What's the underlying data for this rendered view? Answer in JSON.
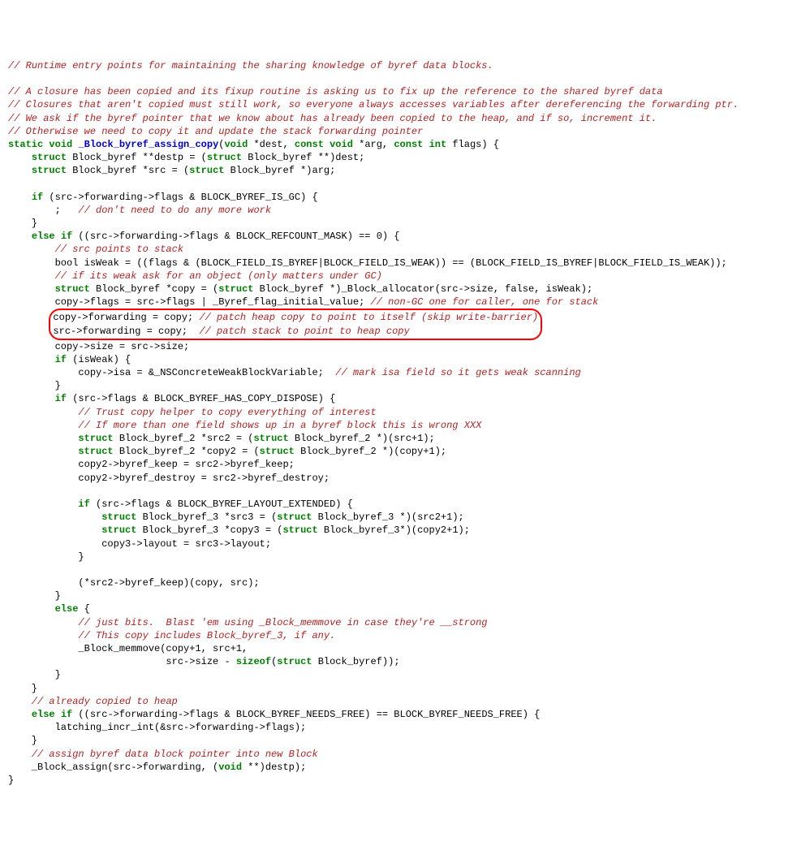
{
  "c1": "// Runtime entry points for maintaining the sharing knowledge of byref data blocks.",
  "blank": "",
  "c2": "// A closure has been copied and its fixup routine is asking us to fix up the reference to the shared byref data",
  "c3": "// Closures that aren't copied must still work, so everyone always accesses variables after dereferencing the forwarding ptr.",
  "c4": "// We ask if the byref pointer that we know about has already been copied to the heap, and if so, increment it.",
  "c5": "// Otherwise we need to copy it and update the stack forwarding pointer",
  "fnsig": {
    "k1": "static",
    "k2": "void",
    "name": "_Block_byref_assign_copy",
    "k3": "void",
    "p1": " *dest, ",
    "k4": "const",
    "k5": "void",
    "p2": " *arg, ",
    "k6": "const",
    "k7": "int",
    "p3": " flags) {"
  },
  "l7": {
    "k": "struct",
    "t1": " Block_byref **destp = (",
    "k2": "struct",
    "t2": " Block_byref **)dest;"
  },
  "l8": {
    "k": "struct",
    "t1": " Block_byref *src = (",
    "k2": "struct",
    "t2": " Block_byref *)arg;"
  },
  "l9": {
    "k": "if",
    "t": " (src->forwarding->flags & BLOCK_BYREF_IS_GC) {"
  },
  "l10": {
    "t": "        ;   ",
    "c": "// don't need to do any more work"
  },
  "l11": "    }",
  "l12": {
    "k1": "else",
    "k2": "if",
    "t": " ((src->forwarding->flags & BLOCK_REFCOUNT_MASK) == 0) {"
  },
  "l13": "// src points to stack",
  "l14": "        bool isWeak = ((flags & (BLOCK_FIELD_IS_BYREF|BLOCK_FIELD_IS_WEAK)) == (BLOCK_FIELD_IS_BYREF|BLOCK_FIELD_IS_WEAK));",
  "l15": "// if its weak ask for an object (only matters under GC)",
  "l16": {
    "k": "struct",
    "t1": " Block_byref *copy = (",
    "k2": "struct",
    "t2": " Block_byref *)_Block_allocator(src->size, false, isWeak);"
  },
  "l17": {
    "t": "        copy->flags = src->flags | _Byref_flag_initial_value; ",
    "c": "// non-GC one for caller, one for stack"
  },
  "hl1": {
    "t": "copy->forwarding = copy; ",
    "c": "// patch heap copy to point to itself (skip write-barrier)"
  },
  "hl2": {
    "t": "src->forwarding = copy;  ",
    "c": "// patch stack to point to heap copy                      "
  },
  "l18": "        copy->size = src->size;",
  "l19": {
    "k": "if",
    "t": " (isWeak) {"
  },
  "l20": {
    "t": "            copy->isa = &_NSConcreteWeakBlockVariable;  ",
    "c": "// mark isa field so it gets weak scanning"
  },
  "l21": "        }",
  "l22": {
    "k": "if",
    "t": " (src->flags & BLOCK_BYREF_HAS_COPY_DISPOSE) {"
  },
  "l23": "// Trust copy helper to copy everything of interest",
  "l24": "// If more than one field shows up in a byref block this is wrong XXX",
  "l25": {
    "k": "struct",
    "t1": " Block_byref_2 *src2 = (",
    "k2": "struct",
    "t2": " Block_byref_2 *)(src+1);"
  },
  "l26": {
    "k": "struct",
    "t1": " Block_byref_2 *copy2 = (",
    "k2": "struct",
    "t2": " Block_byref_2 *)(copy+1);"
  },
  "l27": "            copy2->byref_keep = src2->byref_keep;",
  "l28": "            copy2->byref_destroy = src2->byref_destroy;",
  "l29": {
    "k": "if",
    "t": " (src->flags & BLOCK_BYREF_LAYOUT_EXTENDED) {"
  },
  "l30": {
    "k": "struct",
    "t1": " Block_byref_3 *src3 = (",
    "k2": "struct",
    "t2": " Block_byref_3 *)(src2+1);"
  },
  "l31": {
    "k": "struct",
    "t1": " Block_byref_3 *copy3 = (",
    "k2": "struct",
    "t2": " Block_byref_3*)(copy2+1);"
  },
  "l32": "                copy3->layout = src3->layout;",
  "l33": "            }",
  "l34": "            (*src2->byref_keep)(copy, src);",
  "l35": "        }",
  "l36": {
    "k": "else",
    "t": " {"
  },
  "l37": "// just bits.  Blast 'em using _Block_memmove in case they're __strong",
  "l38": "// This copy includes Block_byref_3, if any.",
  "l39": "            _Block_memmove(copy+1, src+1,",
  "l40": {
    "t1": "                           src->size - ",
    "k": "sizeof",
    "t2": "(",
    "k2": "struct",
    "t3": " Block_byref));"
  },
  "l41": "        }",
  "l42": "    }",
  "l43": "// already copied to heap",
  "l44": {
    "k1": "else",
    "k2": "if",
    "t": " ((src->forwarding->flags & BLOCK_BYREF_NEEDS_FREE) == BLOCK_BYREF_NEEDS_FREE) {"
  },
  "l45": "        latching_incr_int(&src->forwarding->flags);",
  "l46": "    }",
  "l47": "// assign byref data block pointer into new Block",
  "l48": {
    "t1": "    _Block_assign(src->forwarding, (",
    "k": "void",
    "t2": " **)destp);"
  },
  "l49": "}"
}
